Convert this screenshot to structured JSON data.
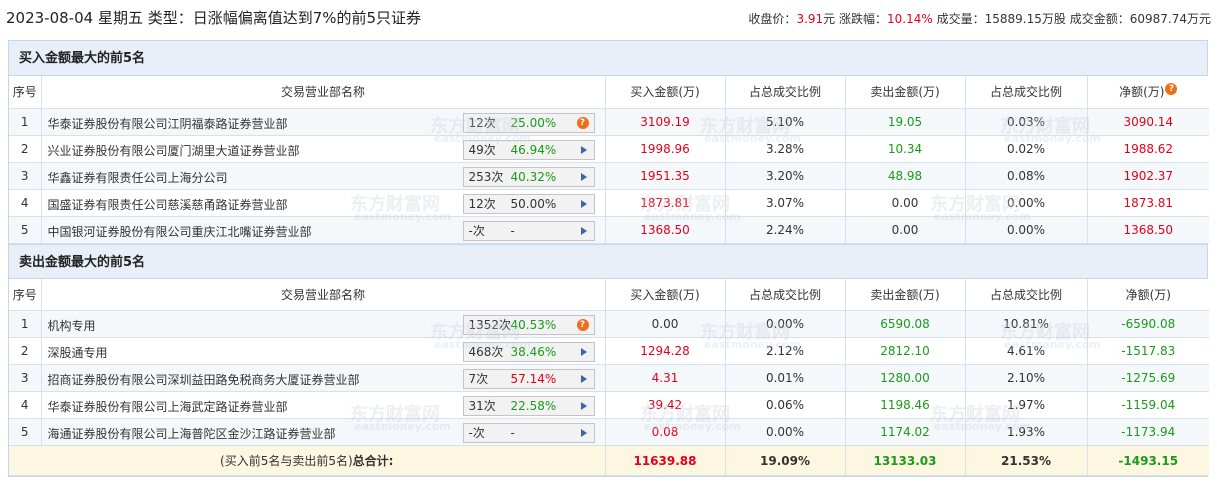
{
  "header": {
    "title": "2023-08-04 星期五 类型：日涨幅偏离值达到7%的前5只证券",
    "close_label": "收盘价：",
    "close_value": "3.91",
    "close_unit": "元",
    "change_label": "涨跌幅：",
    "change_value": "10.14%",
    "volume_label": "成交量：",
    "volume_value": "15889.15万股",
    "amount_label": "成交金额：",
    "amount_value": "60987.74万元"
  },
  "columns": {
    "seq": "序号",
    "name": "交易营业部名称",
    "buy": "买入金额(万)",
    "buy_ratio": "占总成交比例",
    "sell": "卖出金额(万)",
    "sell_ratio": "占总成交比例",
    "net": "净额(万)"
  },
  "buy_section": {
    "title": "买入金额最大的前5名",
    "rows": [
      {
        "seq": "1",
        "name": "华泰证券股份有限公司江阴福泰路证券营业部",
        "count": "12次",
        "pct": "25.00%",
        "pct_color": "green",
        "icon": "question",
        "buy": "3109.19",
        "buy_ratio": "5.10%",
        "sell": "19.05",
        "sell_ratio": "0.03%",
        "net": "3090.14",
        "net_color": "red"
      },
      {
        "seq": "2",
        "name": "兴业证券股份有限公司厦门湖里大道证券营业部",
        "count": "49次",
        "pct": "46.94%",
        "pct_color": "green",
        "icon": "arrow",
        "buy": "1998.96",
        "buy_ratio": "3.28%",
        "sell": "10.34",
        "sell_ratio": "0.02%",
        "net": "1988.62",
        "net_color": "red"
      },
      {
        "seq": "3",
        "name": "华鑫证券有限责任公司上海分公司",
        "count": "253次",
        "pct": "40.32%",
        "pct_color": "green",
        "icon": "arrow",
        "buy": "1951.35",
        "buy_ratio": "3.20%",
        "sell": "48.98",
        "sell_ratio": "0.08%",
        "net": "1902.37",
        "net_color": "red"
      },
      {
        "seq": "4",
        "name": "国盛证券有限责任公司慈溪慈甬路证券营业部",
        "count": "12次",
        "pct": "50.00%",
        "pct_color": "plain",
        "icon": "arrow",
        "buy": "1873.81",
        "buy_ratio": "3.07%",
        "sell": "0.00",
        "sell_ratio": "0.00%",
        "net": "1873.81",
        "net_color": "red"
      },
      {
        "seq": "5",
        "name": "中国银河证券股份有限公司重庆江北嘴证券营业部",
        "count": "-次",
        "pct": "-",
        "pct_color": "plain",
        "icon": "arrow",
        "buy": "1368.50",
        "buy_ratio": "2.24%",
        "sell": "0.00",
        "sell_ratio": "0.00%",
        "net": "1368.50",
        "net_color": "red"
      }
    ]
  },
  "sell_section": {
    "title": "卖出金额最大的前5名",
    "rows": [
      {
        "seq": "1",
        "name": "机构专用",
        "count": "1352次",
        "pct": "40.53%",
        "pct_color": "green",
        "icon": "question",
        "buy": "0.00",
        "buy_ratio": "0.00%",
        "sell": "6590.08",
        "sell_ratio": "10.81%",
        "net": "-6590.08",
        "net_color": "green"
      },
      {
        "seq": "2",
        "name": "深股通专用",
        "count": "468次",
        "pct": "38.46%",
        "pct_color": "green",
        "icon": "arrow",
        "buy": "1294.28",
        "buy_ratio": "2.12%",
        "sell": "2812.10",
        "sell_ratio": "4.61%",
        "net": "-1517.83",
        "net_color": "green"
      },
      {
        "seq": "3",
        "name": "招商证券股份有限公司深圳益田路免税商务大厦证券营业部",
        "count": "7次",
        "pct": "57.14%",
        "pct_color": "red",
        "icon": "arrow",
        "buy": "4.31",
        "buy_ratio": "0.01%",
        "sell": "1280.00",
        "sell_ratio": "2.10%",
        "net": "-1275.69",
        "net_color": "green"
      },
      {
        "seq": "4",
        "name": "华泰证券股份有限公司上海武定路证券营业部",
        "count": "31次",
        "pct": "22.58%",
        "pct_color": "green",
        "icon": "arrow",
        "buy": "39.42",
        "buy_ratio": "0.06%",
        "sell": "1198.46",
        "sell_ratio": "1.97%",
        "net": "-1159.04",
        "net_color": "green"
      },
      {
        "seq": "5",
        "name": "海通证券股份有限公司上海普陀区金沙江路证券营业部",
        "count": "-次",
        "pct": "-",
        "pct_color": "plain",
        "icon": "arrow",
        "buy": "0.08",
        "buy_ratio": "0.00%",
        "sell": "1174.02",
        "sell_ratio": "1.93%",
        "net": "-1173.94",
        "net_color": "green"
      }
    ]
  },
  "total": {
    "label_prefix": "(买入前5名与卖出前5名)",
    "label_bold": "总合计:",
    "buy": "11639.88",
    "buy_ratio": "19.09%",
    "sell": "13133.03",
    "sell_ratio": "21.53%",
    "net": "-1493.15"
  },
  "colors": {
    "red": "#e5001a",
    "green": "#1b9a1b",
    "section_bg": "#e8eff8",
    "total_bg": "#fdf6e0",
    "border": "#c6d7e6"
  },
  "watermark": {
    "text_cn": "东方财富网",
    "text_en": "eastmoney.com"
  }
}
